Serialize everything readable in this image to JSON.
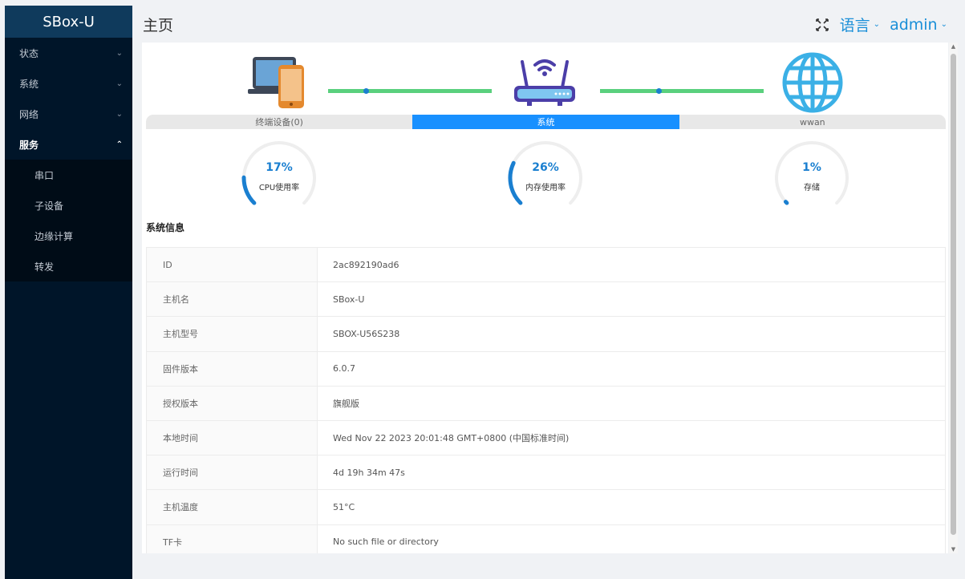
{
  "sidebar": {
    "brand": "SBox-U",
    "menu": [
      {
        "label": "状态",
        "arrow": "⌄"
      },
      {
        "label": "系统",
        "arrow": "⌄"
      },
      {
        "label": "网络",
        "arrow": "⌄"
      },
      {
        "label": "服务",
        "arrow": "⌃"
      }
    ],
    "submenu": [
      "串口",
      "子设备",
      "边缘计算",
      "转发"
    ]
  },
  "header": {
    "title": "主页",
    "language": "语言",
    "user": "admin",
    "caret": "⌄"
  },
  "topology": {
    "tabs": [
      "终端设备(0)",
      "系统",
      "wwan"
    ],
    "active_tab": "系统",
    "colors": {
      "line": "#5ad07e",
      "accent": "#1890ff"
    }
  },
  "gauges": [
    {
      "value_text": "17%",
      "value": 17,
      "label": "CPU使用率"
    },
    {
      "value_text": "26%",
      "value": 26,
      "label": "内存使用率"
    },
    {
      "value_text": "1%",
      "value": 1,
      "label": "存储"
    }
  ],
  "system_info": {
    "title": "系统信息",
    "rows": [
      {
        "key": "ID",
        "value": "2ac892190ad6"
      },
      {
        "key": "主机名",
        "value": "SBox-U"
      },
      {
        "key": "主机型号",
        "value": "SBOX-U56S238"
      },
      {
        "key": "固件版本",
        "value": "6.0.7"
      },
      {
        "key": "授权版本",
        "value": "旗舰版"
      },
      {
        "key": "本地时间",
        "value": "Wed Nov 22 2023 20:01:48 GMT+0800 (中国标准时间)"
      },
      {
        "key": "运行时间",
        "value": "4d 19h 34m 47s"
      },
      {
        "key": "主机温度",
        "value": "51°C"
      },
      {
        "key": "TF卡",
        "value": "No such file or directory"
      }
    ]
  }
}
